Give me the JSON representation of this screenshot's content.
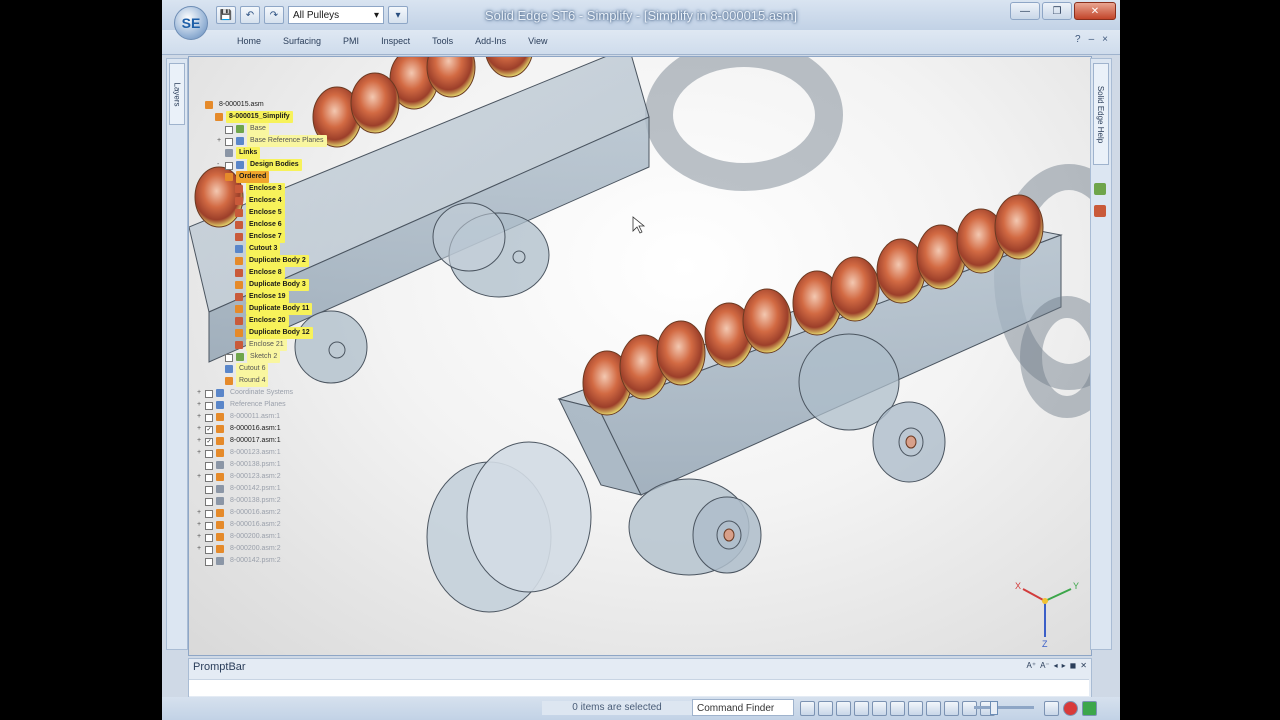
{
  "window": {
    "title": "Solid Edge ST6 - Simplify - [Simplify in 8-000015.asm]"
  },
  "quick_access": {
    "orb_label": "SE",
    "selector_value": "All Pulleys"
  },
  "ribbon": {
    "tabs": [
      "Home",
      "Surfacing",
      "PMI",
      "Inspect",
      "Tools",
      "Add-Ins",
      "View"
    ]
  },
  "left_strip": {
    "tab_label": "Layers"
  },
  "right_strip": {
    "tab_label": "Solid Edge Help"
  },
  "tree": {
    "rows": [
      {
        "label": "8-000015.asm",
        "style": "plain",
        "indent": 0,
        "icon": "ic-orange",
        "cb": false,
        "ex": ""
      },
      {
        "label": "8-000015_Simplify",
        "style": "hl",
        "indent": 1,
        "icon": "ic-orange",
        "cb": false,
        "ex": ""
      },
      {
        "label": "Base",
        "style": "hl-light",
        "indent": 2,
        "icon": "ic-green",
        "cb": true,
        "ex": ""
      },
      {
        "label": "Base Reference Planes",
        "style": "hl-light",
        "indent": 2,
        "icon": "ic-blue",
        "cb": true,
        "ex": "+"
      },
      {
        "label": "Links",
        "style": "hl",
        "indent": 2,
        "icon": "ic-gray",
        "cb": false,
        "ex": ""
      },
      {
        "label": "Design Bodies",
        "style": "hl",
        "indent": 2,
        "icon": "ic-blue",
        "cb": true,
        "ex": "-"
      },
      {
        "label": "Ordered",
        "style": "hl-sel",
        "indent": 2,
        "icon": "ic-orange",
        "cb": false,
        "ex": ""
      },
      {
        "label": "Enclose 3",
        "style": "hl",
        "indent": 3,
        "icon": "ic-red",
        "cb": false,
        "ex": ""
      },
      {
        "label": "Enclose 4",
        "style": "hl",
        "indent": 3,
        "icon": "ic-red",
        "cb": false,
        "ex": ""
      },
      {
        "label": "Enclose 5",
        "style": "hl",
        "indent": 3,
        "icon": "ic-red",
        "cb": false,
        "ex": ""
      },
      {
        "label": "Enclose 6",
        "style": "hl",
        "indent": 3,
        "icon": "ic-red",
        "cb": false,
        "ex": ""
      },
      {
        "label": "Enclose 7",
        "style": "hl",
        "indent": 3,
        "icon": "ic-red",
        "cb": false,
        "ex": ""
      },
      {
        "label": "Cutout 3",
        "style": "hl",
        "indent": 3,
        "icon": "ic-blue",
        "cb": false,
        "ex": ""
      },
      {
        "label": "Duplicate Body 2",
        "style": "hl",
        "indent": 3,
        "icon": "ic-orange",
        "cb": false,
        "ex": ""
      },
      {
        "label": "Enclose 8",
        "style": "hl",
        "indent": 3,
        "icon": "ic-red",
        "cb": false,
        "ex": ""
      },
      {
        "label": "Duplicate Body 3",
        "style": "hl",
        "indent": 3,
        "icon": "ic-orange",
        "cb": false,
        "ex": ""
      },
      {
        "label": "Enclose 19",
        "style": "hl",
        "indent": 3,
        "icon": "ic-red",
        "cb": false,
        "ex": ""
      },
      {
        "label": "Duplicate Body 11",
        "style": "hl",
        "indent": 3,
        "icon": "ic-orange",
        "cb": false,
        "ex": ""
      },
      {
        "label": "Enclose 20",
        "style": "hl",
        "indent": 3,
        "icon": "ic-red",
        "cb": false,
        "ex": ""
      },
      {
        "label": "Duplicate Body 12",
        "style": "hl",
        "indent": 3,
        "icon": "ic-orange",
        "cb": false,
        "ex": ""
      },
      {
        "label": "Enclose 21",
        "style": "hl-light",
        "indent": 3,
        "icon": "ic-red",
        "cb": false,
        "ex": ""
      },
      {
        "label": "Sketch 2",
        "style": "hl-light",
        "indent": 2,
        "icon": "ic-green",
        "cb": true,
        "ex": ""
      },
      {
        "label": "Cutout 6",
        "style": "hl-light",
        "indent": 2,
        "icon": "ic-blue",
        "cb": false,
        "ex": ""
      },
      {
        "label": "Round 4",
        "style": "hl-light",
        "indent": 2,
        "icon": "ic-orange",
        "cb": false,
        "ex": ""
      },
      {
        "label": "Coordinate Systems",
        "style": "dim",
        "indent": 0,
        "icon": "ic-blue",
        "cb": true,
        "ex": "+"
      },
      {
        "label": "Reference Planes",
        "style": "dim",
        "indent": 0,
        "icon": "ic-blue",
        "cb": true,
        "ex": "+"
      },
      {
        "label": "8-000011.asm:1",
        "style": "dim",
        "indent": 0,
        "icon": "ic-orange",
        "cb": true,
        "ex": "+"
      },
      {
        "label": "8-000016.asm:1",
        "style": "plain",
        "indent": 0,
        "icon": "ic-orange",
        "cb": true,
        "checked": true,
        "ex": "+"
      },
      {
        "label": "8-000017.asm:1",
        "style": "plain",
        "indent": 0,
        "icon": "ic-orange",
        "cb": true,
        "checked": true,
        "ex": "+"
      },
      {
        "label": "8-000123.asm:1",
        "style": "dim",
        "indent": 0,
        "icon": "ic-orange",
        "cb": true,
        "ex": "+"
      },
      {
        "label": "8-000138.psm:1",
        "style": "dim",
        "indent": 0,
        "icon": "ic-gray",
        "cb": true,
        "ex": ""
      },
      {
        "label": "8-000123.asm:2",
        "style": "dim",
        "indent": 0,
        "icon": "ic-orange",
        "cb": true,
        "ex": "+"
      },
      {
        "label": "8-000142.psm:1",
        "style": "dim",
        "indent": 0,
        "icon": "ic-gray",
        "cb": true,
        "ex": ""
      },
      {
        "label": "8-000138.psm:2",
        "style": "dim",
        "indent": 0,
        "icon": "ic-gray",
        "cb": true,
        "ex": ""
      },
      {
        "label": "8-000016.asm:2",
        "style": "dim",
        "indent": 0,
        "icon": "ic-orange",
        "cb": true,
        "ex": "+"
      },
      {
        "label": "8-000016.asm:2",
        "style": "dim",
        "indent": 0,
        "icon": "ic-orange",
        "cb": true,
        "ex": "+"
      },
      {
        "label": "8-000200.asm:1",
        "style": "dim",
        "indent": 0,
        "icon": "ic-orange",
        "cb": true,
        "ex": "+"
      },
      {
        "label": "8-000200.asm:2",
        "style": "dim",
        "indent": 0,
        "icon": "ic-orange",
        "cb": true,
        "ex": "+"
      },
      {
        "label": "8-000142.psm:2",
        "style": "dim",
        "indent": 0,
        "icon": "ic-gray",
        "cb": true,
        "ex": ""
      }
    ]
  },
  "triad": {
    "x": "X",
    "y": "Y",
    "z": "Z"
  },
  "promptbar": {
    "title": "PromptBar",
    "controls": [
      "A⁺",
      "A⁻",
      "◂",
      "▸",
      "◼",
      "✕"
    ]
  },
  "statusbar": {
    "selection_text": "0 items are selected",
    "command_finder": "Command Finder"
  },
  "colors": {
    "accent": "#f7f25a",
    "selection": "#f1a52c",
    "chrome": "#cfd9e6"
  }
}
